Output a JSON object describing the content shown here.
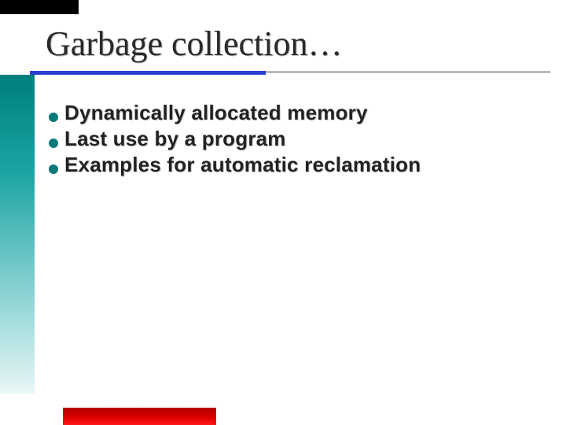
{
  "title": "Garbage collection…",
  "bullets": [
    "Dynamically allocated memory",
    "Last use by a program",
    "Examples for automatic reclamation"
  ],
  "colors": {
    "accent_teal": "#0b7a7a",
    "underline_blue": "#2a3fcf",
    "bottom_red": "#b30000"
  }
}
